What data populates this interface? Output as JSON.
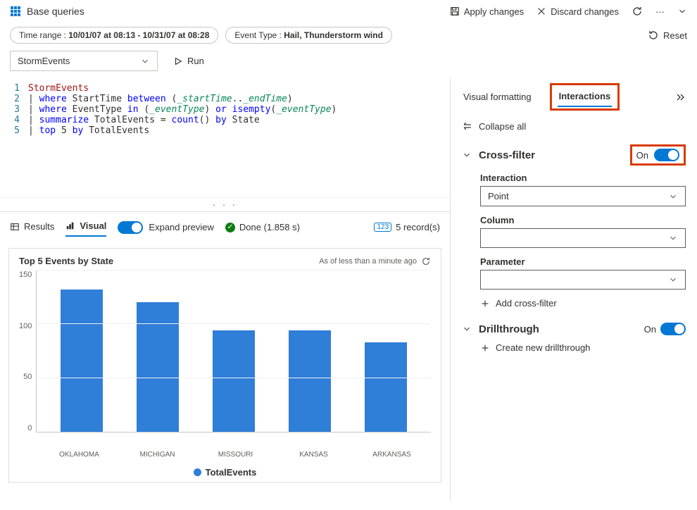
{
  "header": {
    "title": "Base queries",
    "apply": "Apply changes",
    "discard": "Discard changes"
  },
  "filters": {
    "time_range_label": "Time range : ",
    "time_range_value": "10/01/07 at 08:13 - 10/31/07 at 08:28",
    "event_type_label": "Event Type : ",
    "event_type_value": "Hail, Thunderstorm wind",
    "reset": "Reset"
  },
  "source": {
    "selected": "StormEvents",
    "run": "Run"
  },
  "code": {
    "lines": [
      {
        "n": 1,
        "segments": [
          [
            "storm",
            "StormEvents"
          ]
        ]
      },
      {
        "n": 2,
        "segments": [
          [
            "plain",
            "| "
          ],
          [
            "kw",
            "where"
          ],
          [
            "plain",
            " StartTime "
          ],
          [
            "kw",
            "between"
          ],
          [
            "plain",
            " ("
          ],
          [
            "param",
            "_startTime"
          ],
          [
            "plain",
            ".."
          ],
          [
            "param",
            "_endTime"
          ],
          [
            "plain",
            ")"
          ]
        ]
      },
      {
        "n": 3,
        "segments": [
          [
            "plain",
            "| "
          ],
          [
            "kw",
            "where"
          ],
          [
            "plain",
            " EventType "
          ],
          [
            "kw",
            "in"
          ],
          [
            "plain",
            " ("
          ],
          [
            "param",
            "_eventType"
          ],
          [
            "plain",
            ") "
          ],
          [
            "kw",
            "or"
          ],
          [
            "plain",
            " "
          ],
          [
            "fn",
            "isempty"
          ],
          [
            "plain",
            "("
          ],
          [
            "param",
            "_eventType"
          ],
          [
            "plain",
            ")"
          ]
        ]
      },
      {
        "n": 4,
        "segments": [
          [
            "plain",
            "| "
          ],
          [
            "kw",
            "summarize"
          ],
          [
            "plain",
            " TotalEvents = "
          ],
          [
            "fn",
            "count"
          ],
          [
            "plain",
            "() "
          ],
          [
            "kw",
            "by"
          ],
          [
            "plain",
            " State"
          ]
        ]
      },
      {
        "n": 5,
        "segments": [
          [
            "plain",
            "| "
          ],
          [
            "kw",
            "top"
          ],
          [
            "plain",
            " 5 "
          ],
          [
            "kw",
            "by"
          ],
          [
            "plain",
            " TotalEvents"
          ]
        ]
      }
    ]
  },
  "results_bar": {
    "results_tab": "Results",
    "visual_tab": "Visual",
    "expand": "Expand preview",
    "done": "Done (1.858 s)",
    "records": "5 record(s)"
  },
  "chart": {
    "title": "Top 5 Events by State",
    "asof": "As of less than a minute ago",
    "legend": "TotalEvents"
  },
  "right": {
    "visual_formatting": "Visual formatting",
    "interactions": "Interactions",
    "collapse_all": "Collapse all",
    "cross_filter": "Cross-filter",
    "on": "On",
    "interaction": "Interaction",
    "interaction_value": "Point",
    "column": "Column",
    "parameter": "Parameter",
    "add_cross_filter": "Add cross-filter",
    "drillthrough": "Drillthrough",
    "create_drill": "Create new drillthrough"
  },
  "chart_data": {
    "type": "bar",
    "title": "Top 5 Events by State",
    "categories": [
      "OKLAHOMA",
      "MICHIGAN",
      "MISSOURI",
      "KANSAS",
      "ARKANSAS"
    ],
    "values": [
      132,
      120,
      94,
      94,
      83
    ],
    "series_name": "TotalEvents",
    "ylim": [
      0,
      150
    ],
    "yticks": [
      0,
      50,
      100,
      150
    ],
    "xlabel": "",
    "ylabel": ""
  }
}
